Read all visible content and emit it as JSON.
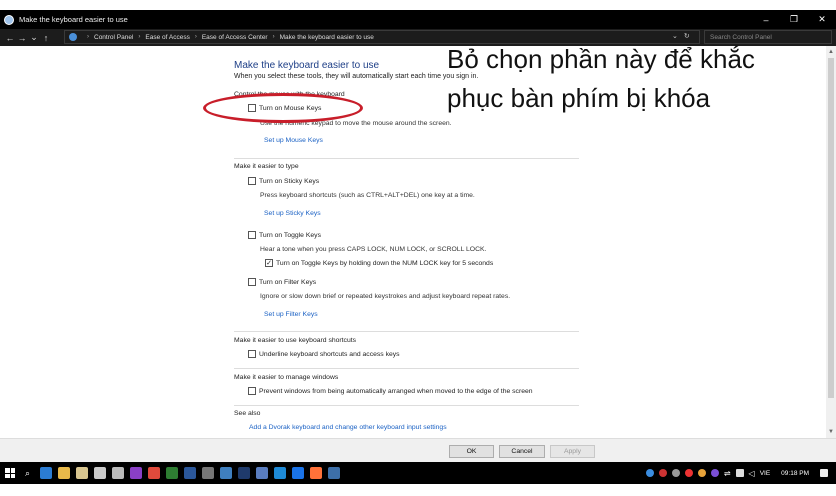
{
  "window": {
    "title": "Make the keyboard easier to use",
    "controls": [
      "–",
      "❐",
      "✕"
    ]
  },
  "addressbar": {
    "nav": [
      "←",
      "→",
      "⌄",
      "↑"
    ],
    "breadcrumb": [
      "Control Panel",
      "Ease of Access",
      "Ease of Access Center",
      "Make the keyboard easier to use"
    ],
    "dropdown_glyph": "⌄",
    "refresh_glyph": "↻",
    "search_placeholder": "Search Control Panel"
  },
  "page": {
    "title": "Make the keyboard easier to use",
    "subtitle": "When you select these tools, they will automatically start each time you sign in.",
    "mouse_section": {
      "label": "Control the mouse with the keyboard",
      "option": "Turn on Mouse Keys",
      "option_checked": false,
      "desc": "Use the numeric keypad to move the mouse around the screen.",
      "link": "Set up Mouse Keys"
    },
    "typing_section": {
      "label": "Make it easier to type",
      "sticky": {
        "option": "Turn on Sticky Keys",
        "checked": false,
        "desc": "Press keyboard shortcuts (such as CTRL+ALT+DEL) one key at a time.",
        "link": "Set up Sticky Keys"
      },
      "toggle": {
        "option": "Turn on Toggle Keys",
        "checked": false,
        "desc": "Hear a tone when you press CAPS LOCK, NUM LOCK, or SCROLL LOCK.",
        "sub_option": "Turn on Toggle Keys by holding down the NUM LOCK key for 5 seconds",
        "sub_checked": true
      },
      "filter": {
        "option": "Turn on Filter Keys",
        "checked": false,
        "desc": "Ignore or slow down brief or repeated keystrokes and adjust keyboard repeat rates.",
        "link": "Set up Filter Keys"
      }
    },
    "shortcuts_section": {
      "label": "Make it easier to use keyboard shortcuts",
      "option": "Underline keyboard shortcuts and access keys",
      "checked": false
    },
    "windows_section": {
      "label": "Make it easier to manage windows",
      "option": "Prevent windows from being automatically arranged when moved to the edge of the screen",
      "checked": false
    },
    "see_also": {
      "label": "See also",
      "link": "Add a Dvorak keyboard and change other keyboard input settings"
    }
  },
  "annotation": {
    "text": "Bỏ chọn phần này để khắc phục bàn phím bị khóa",
    "color": "#c81e2a"
  },
  "buttons": {
    "ok": "OK",
    "cancel": "Cancel",
    "apply": "Apply"
  },
  "taskbar": {
    "language": "VIE",
    "time": "09:18 PM"
  },
  "scrollbar": {
    "up_glyph": "▲",
    "down_glyph": "▼"
  }
}
